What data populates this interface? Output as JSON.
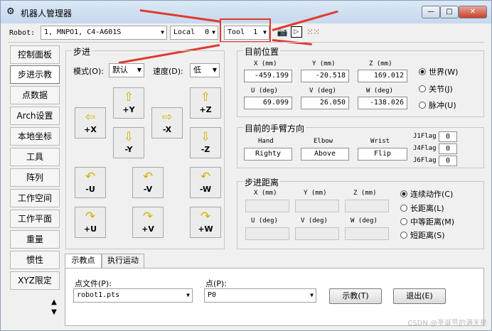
{
  "window": {
    "title": "机器人管理器",
    "controls": [
      "—",
      "□",
      "✕"
    ]
  },
  "toolbar": {
    "robot_label": "Robot:",
    "robot_value": "1, MNPO1, C4-A601S",
    "local_label": "Local",
    "local_value": "0",
    "tool_label": "Tool",
    "tool_value": "1",
    "icons": [
      "camera-icon",
      "terminal-icon",
      "dots-grid-icon"
    ]
  },
  "sidebar": {
    "items": [
      "控制面板",
      "步进示教",
      "点数据",
      "Arch设置",
      "本地坐标",
      "工具",
      "阵列",
      "工作空间",
      "工作平面",
      "重量",
      "惯性",
      "XYZ限定"
    ],
    "active_index": 1
  },
  "jog": {
    "group_title": "步进",
    "mode_label": "模式(O):",
    "mode_value": "默认",
    "speed_label": "速度(D):",
    "speed_value": "低",
    "buttons": [
      "+Y",
      "+Z",
      "+X",
      "-X",
      "-Y",
      "-Z",
      "-U",
      "-V",
      "-W",
      "+U",
      "+V",
      "+W"
    ]
  },
  "position": {
    "title": "目前位置",
    "headers": [
      "X (mm)",
      "Y (mm)",
      "Z (mm)",
      "U (deg)",
      "V (deg)",
      "W (deg)"
    ],
    "values": [
      "-459.199",
      "-20.518",
      "169.012",
      "69.099",
      "26.050",
      "-138.026"
    ],
    "modes": [
      "世界(W)",
      "关节(J)",
      "脉冲(U)"
    ],
    "selected_mode": 0
  },
  "arm": {
    "title": "目前的手臂方向",
    "headers": [
      "Hand",
      "Elbow",
      "Wrist"
    ],
    "values": [
      "Righty",
      "Above",
      "Flip"
    ],
    "flags": [
      {
        "label": "J1Flag",
        "value": "0"
      },
      {
        "label": "J4Flag",
        "value": "0"
      },
      {
        "label": "J6Flag",
        "value": "0"
      }
    ]
  },
  "step": {
    "title": "步进距离",
    "headers": [
      "X (mm)",
      "Y (mm)",
      "Z (mm)",
      "U (deg)",
      "V (deg)",
      "W (deg)"
    ],
    "options": [
      "连续动作(C)",
      "长距离(L)",
      "中等距离(M)",
      "短距离(S)"
    ],
    "selected_option": 0
  },
  "teach": {
    "tabs": [
      "示教点",
      "执行运动"
    ],
    "active_tab": 0,
    "file_label": "点文件(P):",
    "file_value": "robot1.pts",
    "point_label": "点(P):",
    "point_value": "P0",
    "teach_button": "示教(T)",
    "exit_button": "退出(E)"
  },
  "watermark": "CSDN @圣诞节的满天星"
}
